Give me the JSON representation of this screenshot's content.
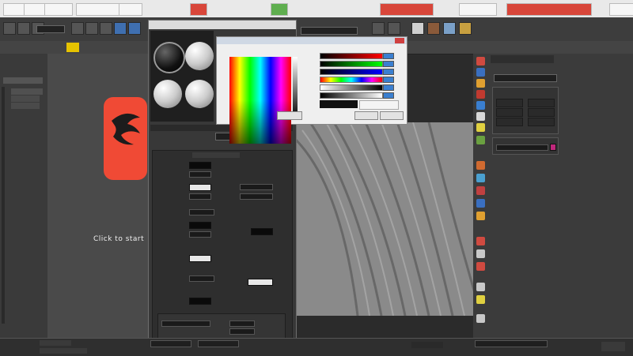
{
  "colors": {
    "logo_red": "#f04a35",
    "hue_swatch_magenta": "#c0287c"
  },
  "viewport_left": {
    "start_text": "Click to start"
  },
  "material_editor": {
    "title": "",
    "basic_params_header": "",
    "map_channel_selected": ""
  },
  "color_selector": {
    "title": "",
    "ok_label": "",
    "cancel_label": ""
  },
  "right_panel": {
    "modifier_list_label": ""
  },
  "icons": [
    "max-logo-icon",
    "undo-icon",
    "redo-icon",
    "select-icon",
    "move-icon",
    "rotate-icon",
    "scale-icon",
    "render-icon",
    "material-sphere-icon",
    "close-icon"
  ]
}
